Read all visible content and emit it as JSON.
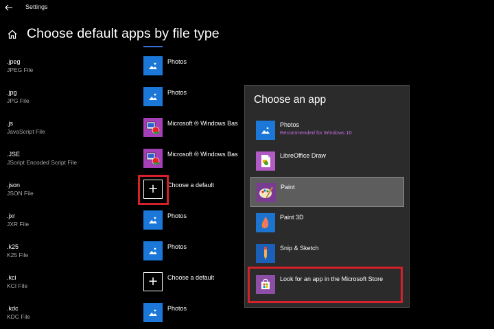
{
  "window": {
    "title": "Settings"
  },
  "header": {
    "title": "Choose default apps by file type"
  },
  "file_types": [
    {
      "ext": ".jpeg",
      "desc": "JPEG File",
      "app": "Photos",
      "icon": "photos-icon"
    },
    {
      "ext": ".jpg",
      "desc": "JPG File",
      "app": "Photos",
      "icon": "photos-icon"
    },
    {
      "ext": ".js",
      "desc": "JavaScript File",
      "app": "Microsoft ® Windows Bas",
      "icon": "windows-script-host-icon"
    },
    {
      "ext": ".JSE",
      "desc": "JScript Encoded Script File",
      "app": "Microsoft ® Windows Bas",
      "icon": "windows-script-host-icon"
    },
    {
      "ext": ".json",
      "desc": "JSON File",
      "app": "Choose a default",
      "icon": "plus-icon"
    },
    {
      "ext": ".jxr",
      "desc": "JXR File",
      "app": "Photos",
      "icon": "photos-icon"
    },
    {
      "ext": ".k25",
      "desc": "K25 File",
      "app": "Photos",
      "icon": "photos-icon"
    },
    {
      "ext": ".kci",
      "desc": "KCI File",
      "app": "Choose a default",
      "icon": "plus-icon"
    },
    {
      "ext": ".kdc",
      "desc": "KDC File",
      "app": "Photos",
      "icon": "photos-icon"
    }
  ],
  "flyout": {
    "title": "Choose an app",
    "items": [
      {
        "name": "Photos",
        "sub": "Recommended for Windows 10",
        "icon": "photos-icon"
      },
      {
        "name": "LibreOffice Draw",
        "icon": "libreoffice-draw-icon"
      },
      {
        "name": "Paint",
        "icon": "paint-icon",
        "selected": true
      },
      {
        "name": "Paint 3D",
        "icon": "paint-3d-icon"
      },
      {
        "name": "Snip & Sketch",
        "icon": "snip-sketch-icon"
      },
      {
        "name": "Look for an app in the Microsoft Store",
        "icon": "microsoft-store-icon"
      }
    ]
  },
  "colors": {
    "background": "#000000",
    "accent": "#1b78d8",
    "highlight_border": "#d6202a",
    "flyout_bg": "#2b2b2b",
    "recommended_text": "#c46fe0"
  }
}
